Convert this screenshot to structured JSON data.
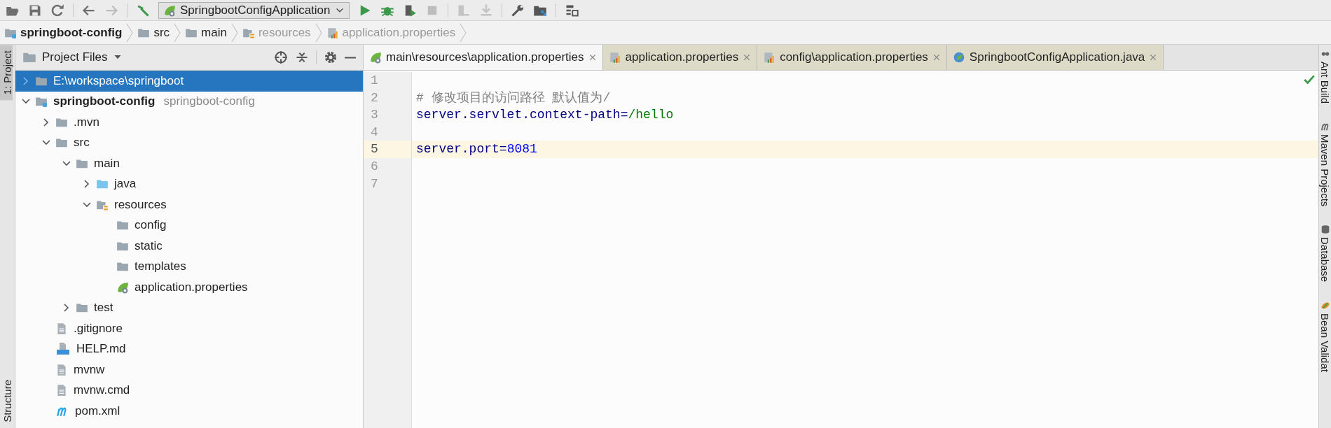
{
  "toolbar": {
    "run_config": "SpringbootConfigApplication"
  },
  "breadcrumbs": [
    {
      "label": "springboot-config",
      "kind": "module",
      "bold": true,
      "dimmed": false
    },
    {
      "label": "src",
      "kind": "folder",
      "bold": false,
      "dimmed": false
    },
    {
      "label": "main",
      "kind": "folder",
      "bold": false,
      "dimmed": false
    },
    {
      "label": "resources",
      "kind": "resources-folder",
      "bold": false,
      "dimmed": true
    },
    {
      "label": "application.properties",
      "kind": "properties",
      "bold": false,
      "dimmed": true
    }
  ],
  "left_stripe": {
    "top": [
      {
        "label": "1: Project",
        "selected": true
      }
    ],
    "bottom": [
      {
        "label": "Structure",
        "selected": false
      }
    ]
  },
  "project": {
    "title": "Project Files",
    "tree": [
      {
        "label": "E:\\workspace\\springboot",
        "kind": "folder",
        "expanded": false,
        "selected": true
      },
      {
        "label": "springboot-config",
        "suffix": "springboot-config",
        "kind": "module",
        "bold": true,
        "expanded": true,
        "selected": false,
        "children": [
          {
            "label": ".mvn",
            "kind": "folder",
            "expanded": false,
            "selected": false
          },
          {
            "label": "src",
            "kind": "folder",
            "expanded": true,
            "selected": false,
            "children": [
              {
                "label": "main",
                "kind": "folder",
                "expanded": true,
                "selected": false,
                "children": [
                  {
                    "label": "java",
                    "kind": "source-folder",
                    "expanded": false,
                    "selected": false
                  },
                  {
                    "label": "resources",
                    "kind": "resources-folder",
                    "expanded": true,
                    "selected": false,
                    "children": [
                      {
                        "label": "config",
                        "kind": "folder",
                        "selected": false
                      },
                      {
                        "label": "static",
                        "kind": "folder",
                        "selected": false
                      },
                      {
                        "label": "templates",
                        "kind": "folder",
                        "selected": false
                      },
                      {
                        "label": "application.properties",
                        "kind": "spring",
                        "selected": false
                      }
                    ]
                  }
                ]
              },
              {
                "label": "test",
                "kind": "folder",
                "expanded": false,
                "selected": false
              }
            ]
          },
          {
            "label": ".gitignore",
            "kind": "text-file",
            "selected": false
          },
          {
            "label": "HELP.md",
            "kind": "markdown",
            "selected": false
          },
          {
            "label": "mvnw",
            "kind": "text-file",
            "selected": false
          },
          {
            "label": "mvnw.cmd",
            "kind": "text-file",
            "selected": false
          },
          {
            "label": "pom.xml",
            "kind": "maven",
            "selected": false
          }
        ]
      }
    ]
  },
  "tabs": [
    {
      "label": "main\\resources\\application.properties",
      "kind": "spring",
      "selected": true
    },
    {
      "label": "application.properties",
      "kind": "properties",
      "selected": false
    },
    {
      "label": "config\\application.properties",
      "kind": "properties",
      "selected": false
    },
    {
      "label": "SpringbootConfigApplication.java",
      "kind": "spring-class",
      "selected": false
    }
  ],
  "editor": {
    "lines": [
      {
        "number": "1",
        "current": false
      },
      {
        "number": "2",
        "current": false,
        "tokens": [
          {
            "kind": "comment",
            "text": "# 修改项目的访问路径 默认值为/"
          }
        ]
      },
      {
        "number": "3",
        "current": false,
        "tokens": [
          {
            "kind": "key",
            "text": "server.servlet.context-path"
          },
          {
            "kind": "separator",
            "text": "="
          },
          {
            "kind": "value",
            "text": "/hello"
          }
        ]
      },
      {
        "number": "4",
        "current": false
      },
      {
        "number": "5",
        "current": true,
        "tokens": [
          {
            "kind": "key",
            "text": "server.port"
          },
          {
            "kind": "separator",
            "text": "="
          },
          {
            "kind": "number",
            "text": "8081"
          }
        ]
      },
      {
        "number": "6",
        "current": false
      },
      {
        "number": "7",
        "current": false
      }
    ]
  },
  "right_stripe": [
    {
      "label": "Ant Build",
      "kind": "ant"
    },
    {
      "label": "Maven Projects",
      "kind": "maven"
    },
    {
      "label": "Database",
      "kind": "database"
    },
    {
      "label": "Bean Validat",
      "kind": "bean"
    }
  ]
}
